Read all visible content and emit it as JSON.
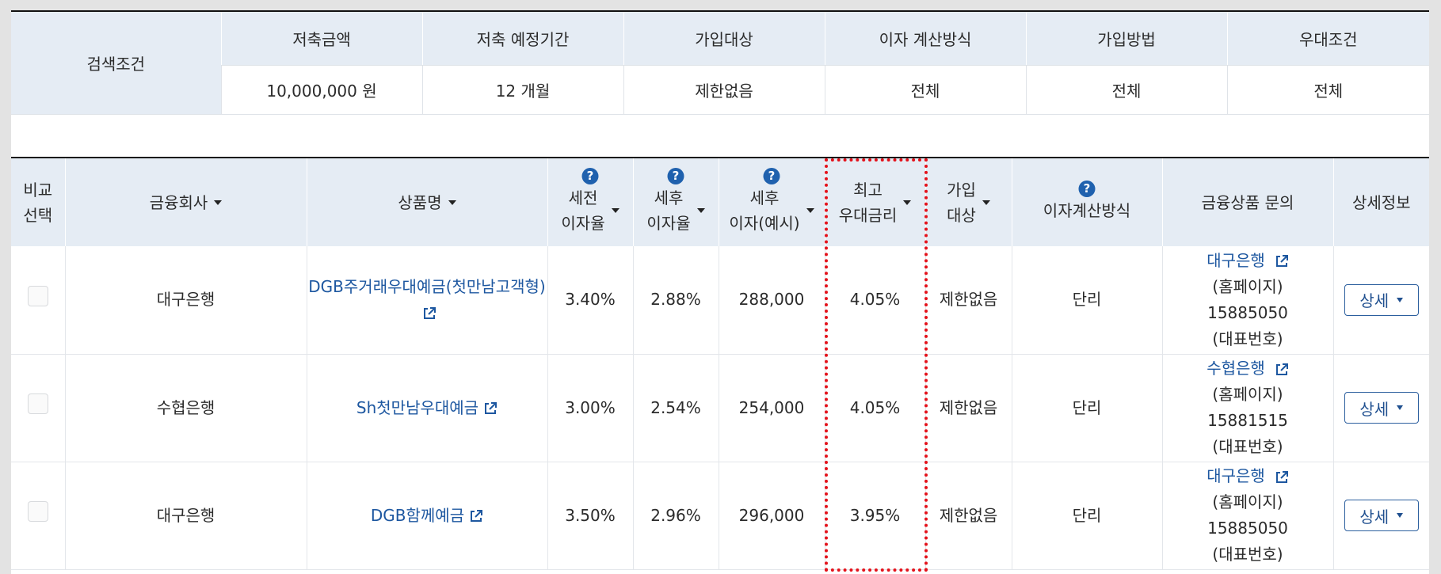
{
  "search": {
    "label": "검색조건",
    "headers": [
      "저축금액",
      "저축 예정기간",
      "가입대상",
      "이자 계산방식",
      "가입방법",
      "우대조건"
    ],
    "values": [
      "10,000,000 원",
      "12 개월",
      "제한없음",
      "전체",
      "전체",
      "전체"
    ]
  },
  "table": {
    "headers": {
      "compare_line1": "비교",
      "compare_line2": "선택",
      "company": "금융회사",
      "product": "상품명",
      "pretax_line1": "세전",
      "pretax_line2": "이자율",
      "aftertax_line1": "세후",
      "aftertax_line2": "이자율",
      "interest_line1": "세후",
      "interest_line2": "이자(예시)",
      "maxrate_line1": "최고",
      "maxrate_line2": "우대금리",
      "target_line1": "가입",
      "target_line2": "대상",
      "calc": "이자계산방식",
      "inquiry": "금융상품 문의",
      "detail": "상세정보"
    },
    "rows": [
      {
        "company": "대구은행",
        "product": "DGB주거래우대예금(첫만남고객형)",
        "pretax": "3.40%",
        "aftertax": "2.88%",
        "interest": "288,000",
        "maxrate": "4.05%",
        "target": "제한없음",
        "calc": "단리",
        "contact_bank": "대구은행",
        "contact_home": "(홈페이지)",
        "contact_phone": "15885050",
        "contact_rep": "(대표번호)",
        "detail_btn": "상세"
      },
      {
        "company": "수협은행",
        "product": "Sh첫만남우대예금",
        "pretax": "3.00%",
        "aftertax": "2.54%",
        "interest": "254,000",
        "maxrate": "4.05%",
        "target": "제한없음",
        "calc": "단리",
        "contact_bank": "수협은행",
        "contact_home": "(홈페이지)",
        "contact_phone": "15881515",
        "contact_rep": "(대표번호)",
        "detail_btn": "상세"
      },
      {
        "company": "대구은행",
        "product": "DGB함께예금",
        "pretax": "3.50%",
        "aftertax": "2.96%",
        "interest": "296,000",
        "maxrate": "3.95%",
        "target": "제한없음",
        "calc": "단리",
        "contact_bank": "대구은행",
        "contact_home": "(홈페이지)",
        "contact_phone": "15885050",
        "contact_rep": "(대표번호)",
        "detail_btn": "상세"
      }
    ]
  },
  "colors": {
    "header_bg": "#e5ecf4",
    "link": "#1d57a0",
    "help_icon": "#1f61ae",
    "highlight": "#e4121b"
  }
}
